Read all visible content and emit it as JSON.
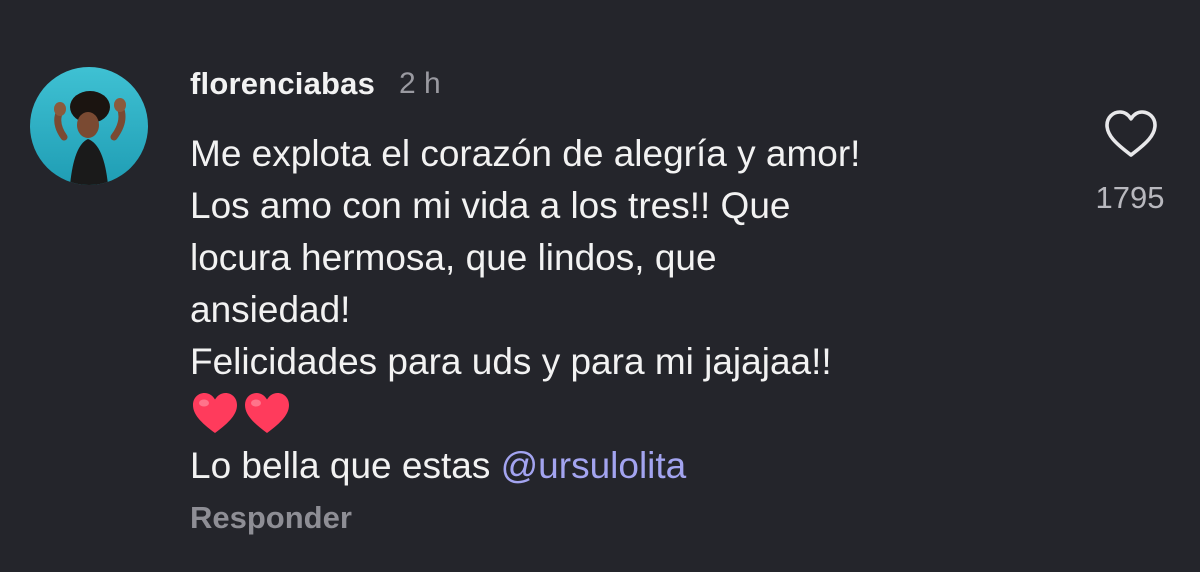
{
  "comment": {
    "username": "florenciabas",
    "time": "2 h",
    "body_lines": [
      "Me explota el corazón de alegría y amor!",
      "Los amo con mi vida a los tres!! Que",
      "locura hermosa, que lindos, que",
      "ansiedad!",
      "Felicidades para uds y para mi jajajaa!!"
    ],
    "emoji": [
      "red-heart",
      "red-heart"
    ],
    "closing_text": "Lo bella que estas ",
    "mention": "@ursulolita",
    "reply_label": "Responder",
    "like_count": "1795"
  },
  "colors": {
    "background": "#24252b",
    "text": "#f2f2f2",
    "muted": "#9a9aa1",
    "mention": "#a3a4f0",
    "heart": "#ff3b5c"
  },
  "icons": {
    "like": "heart-outline-icon",
    "avatar": "user-avatar"
  }
}
